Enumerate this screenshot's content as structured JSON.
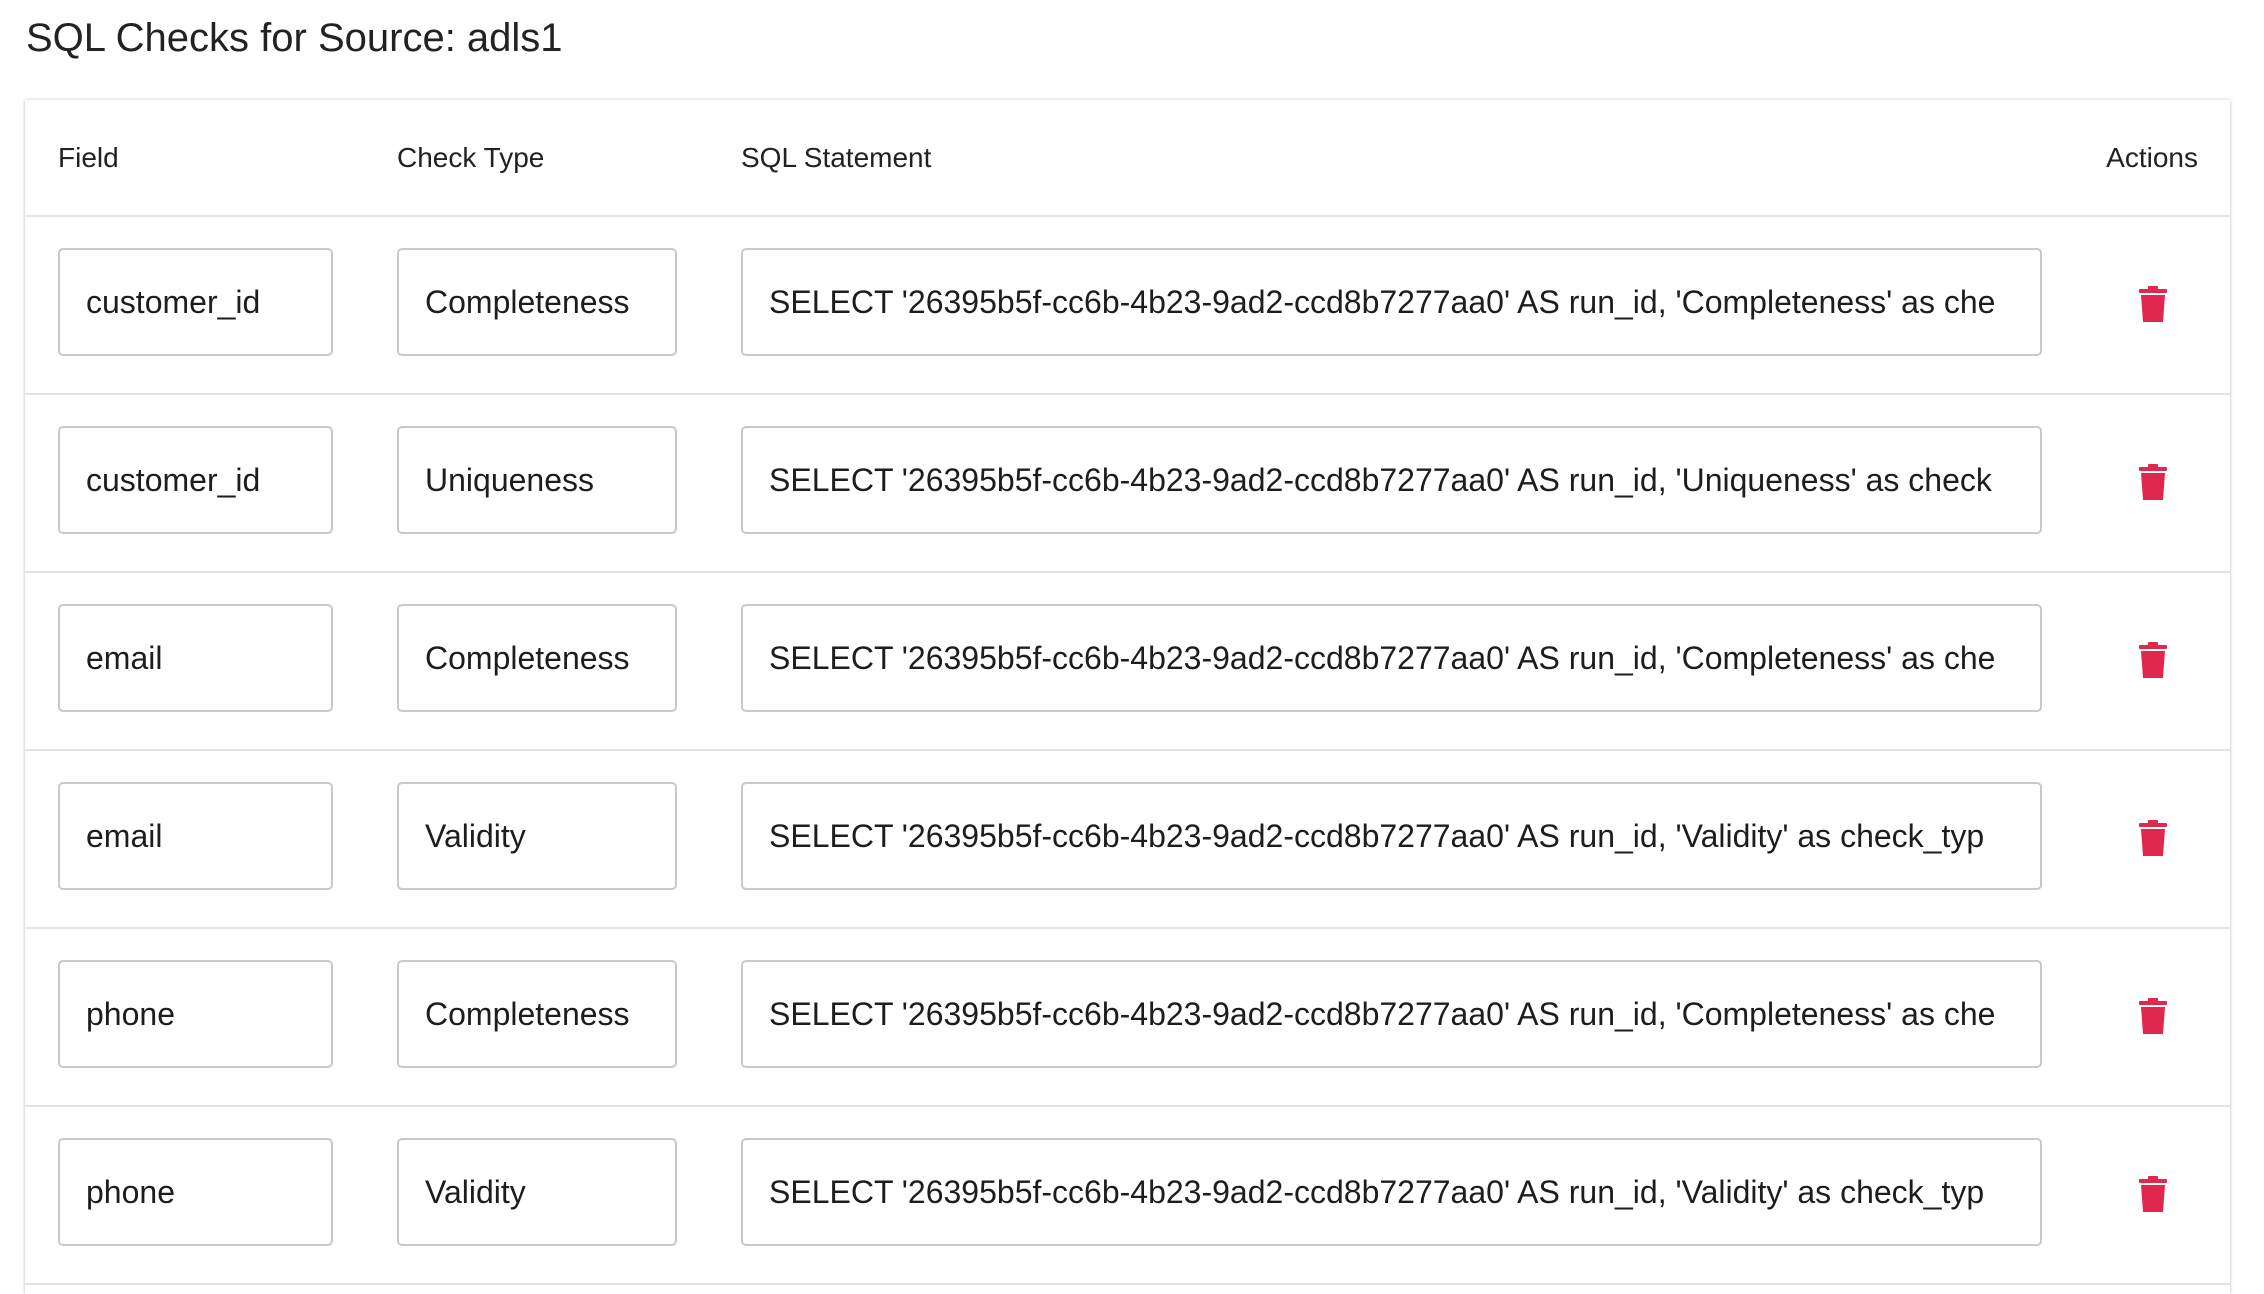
{
  "page": {
    "title": "SQL Checks for Source: adls1"
  },
  "table": {
    "headers": {
      "field": "Field",
      "check_type": "Check Type",
      "sql_statement": "SQL Statement",
      "actions": "Actions"
    },
    "rows": [
      {
        "field": "customer_id",
        "check_type": "Completeness",
        "sql": "SELECT '26395b5f-cc6b-4b23-9ad2-ccd8b7277aa0' AS run_id, 'Completeness' as che"
      },
      {
        "field": "customer_id",
        "check_type": "Uniqueness",
        "sql": "SELECT '26395b5f-cc6b-4b23-9ad2-ccd8b7277aa0' AS run_id, 'Uniqueness' as check"
      },
      {
        "field": "email",
        "check_type": "Completeness",
        "sql": "SELECT '26395b5f-cc6b-4b23-9ad2-ccd8b7277aa0' AS run_id, 'Completeness' as che"
      },
      {
        "field": "email",
        "check_type": "Validity",
        "sql": "SELECT '26395b5f-cc6b-4b23-9ad2-ccd8b7277aa0' AS run_id, 'Validity' as check_typ"
      },
      {
        "field": "phone",
        "check_type": "Completeness",
        "sql": "SELECT '26395b5f-cc6b-4b23-9ad2-ccd8b7277aa0' AS run_id, 'Completeness' as che"
      },
      {
        "field": "phone",
        "check_type": "Validity",
        "sql": "SELECT '26395b5f-cc6b-4b23-9ad2-ccd8b7277aa0' AS run_id, 'Validity' as check_typ"
      }
    ]
  },
  "icons": {
    "delete": "trash-icon"
  },
  "colors": {
    "delete_icon": "#e0284f",
    "border": "#c9c9c9",
    "divider": "#e4e4e4"
  }
}
